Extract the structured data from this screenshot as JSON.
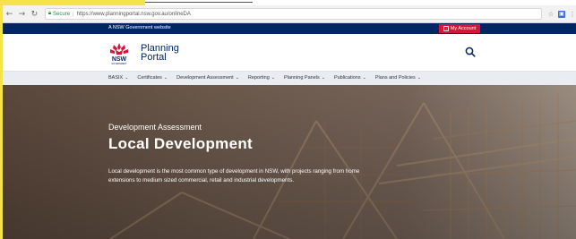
{
  "browser": {
    "secure_label": "Secure",
    "url": "https://www.planningportal.nsw.gov.au/onlineDA",
    "icons": [
      "back-icon",
      "forward-icon",
      "reload-icon",
      "lock-icon",
      "star-icon",
      "extension-icon",
      "menu-icon"
    ]
  },
  "govbar": {
    "text": "A NSW Government website",
    "account_label": "My Account",
    "account_color": "#d7153a",
    "bg_color": "#002664"
  },
  "header": {
    "logo_text": "NSW",
    "logo_subtext": "GOVERNMENT",
    "brand_line1": "Planning",
    "brand_line2": "Portal"
  },
  "nav": {
    "items": [
      {
        "label": "BASIX"
      },
      {
        "label": "Certificates"
      },
      {
        "label": "Development Assessment"
      },
      {
        "label": "Reporting"
      },
      {
        "label": "Planning Panels"
      },
      {
        "label": "Publications"
      },
      {
        "label": "Plans and Policies"
      }
    ]
  },
  "hero": {
    "eyebrow": "Development Assessment",
    "title": "Local Development",
    "description": "Local development is the most common type of development in NSW, with projects ranging from home extensions to medium sized commercial, retail and industrial developments."
  }
}
